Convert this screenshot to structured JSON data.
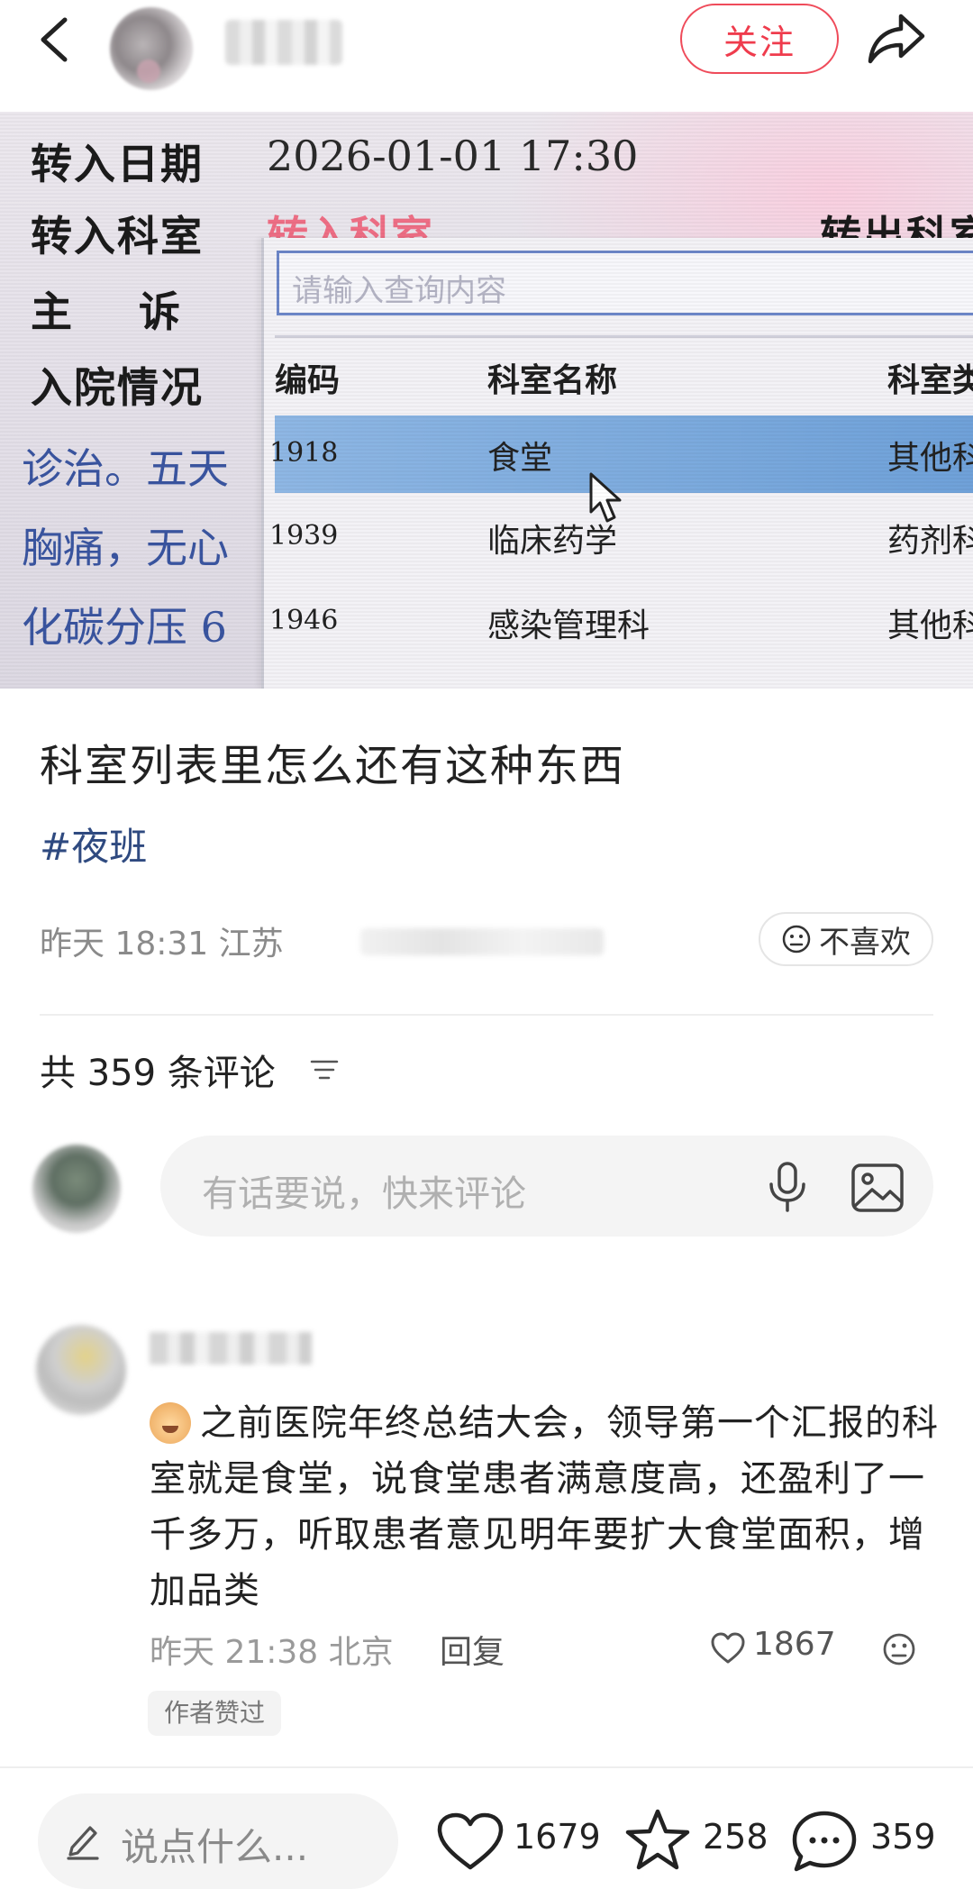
{
  "header": {
    "follow_label": "关注"
  },
  "photo": {
    "form_labels": {
      "transfer_date": "转入日期",
      "transfer_dept": "转入科室",
      "chief_complaint": "主    诉",
      "admission": "入院情况"
    },
    "transfer_date_value": "2026-01-01 17:30",
    "transfer_dept_value": "转入科室",
    "transfer_out_label": "转出科室",
    "search_placeholder": "请输入查询内容",
    "table_headers": [
      "编码",
      "科室名称",
      "科室类"
    ],
    "rows": [
      {
        "code": "1918",
        "name": "食堂",
        "type": "其他科",
        "selected": true
      },
      {
        "code": "1939",
        "name": "临床药学",
        "type": "药剂科",
        "selected": false
      },
      {
        "code": "1946",
        "name": "感染管理科",
        "type": "其他科",
        "selected": false
      }
    ],
    "left_fragments": [
      "诊治。五天",
      "胸痛，无心",
      "化碳分压 6"
    ]
  },
  "post": {
    "title": "科室列表里怎么还有这种东西",
    "hashtag": "#夜班",
    "time_location": "昨天 18:31 江苏",
    "dislike_label": "不喜欢"
  },
  "comments": {
    "count_label": "共 359 条评论",
    "input_placeholder": "有话要说，快来评论",
    "items": [
      {
        "text": "之前医院年终总结大会，领导第一个汇报的科室就是食堂，说食堂患者满意度高，还盈利了一千多万，听取患者意见明年要扩大食堂面积，增加品类",
        "time_location": "昨天 21:38 北京",
        "reply_label": "回复",
        "likes": "1867",
        "badge": "作者赞过"
      }
    ]
  },
  "bottom_bar": {
    "input_placeholder": "说点什么...",
    "likes": "1679",
    "stars": "258",
    "comments": "359"
  },
  "colors": {
    "accent_red": "#ef3c4d",
    "hashtag_blue": "#2f4a80",
    "selected_row": "#7aa8dd"
  }
}
